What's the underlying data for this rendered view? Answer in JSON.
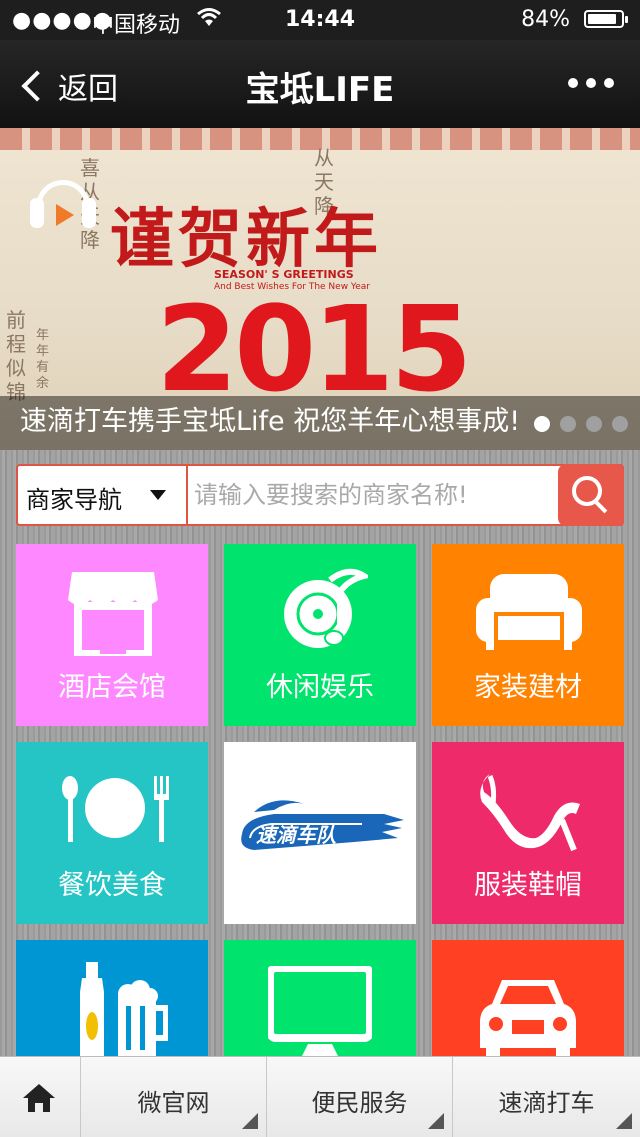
{
  "status_bar": {
    "carrier": "中国移动",
    "time": "14:44",
    "battery": "84%"
  },
  "nav": {
    "back_label": "返回",
    "title": "宝坻LIFE"
  },
  "banner": {
    "greeting": "谨贺新年",
    "season_line1": "SEASON' S GREETINGS",
    "season_line2": "And Best Wishes For The New Year",
    "year": "2015",
    "caption": "速滴打车携手宝坻Life 祝您羊年心想事成!",
    "active_slide": 1,
    "slide_count": 4
  },
  "search": {
    "category": "商家导航",
    "placeholder": "请输入要搜索的商家名称!"
  },
  "tiles": [
    {
      "label": "酒店会馆",
      "color": "#fe88ff",
      "icon": "storefront-icon"
    },
    {
      "label": "休闲娱乐",
      "color": "#00e36c",
      "icon": "music-disc-icon"
    },
    {
      "label": "家装建材",
      "color": "#ff8200",
      "icon": "sofa-icon"
    },
    {
      "label": "餐饮美食",
      "color": "#26c5c5",
      "icon": "plate-cutlery-icon"
    },
    {
      "label": "速滴车队",
      "color": "#ffffff",
      "icon": "sudi-fleet-logo"
    },
    {
      "label": "服装鞋帽",
      "color": "#ef2a6b",
      "icon": "high-heel-icon"
    },
    {
      "label": "",
      "color": "#0095d3",
      "icon": "beer-icon"
    },
    {
      "label": "",
      "color": "#00e36c",
      "icon": "monitor-icon"
    },
    {
      "label": "",
      "color": "#ff4022",
      "icon": "car-icon"
    }
  ],
  "tabbar": {
    "items": [
      "微官网",
      "便民服务",
      "速滴打车"
    ]
  }
}
